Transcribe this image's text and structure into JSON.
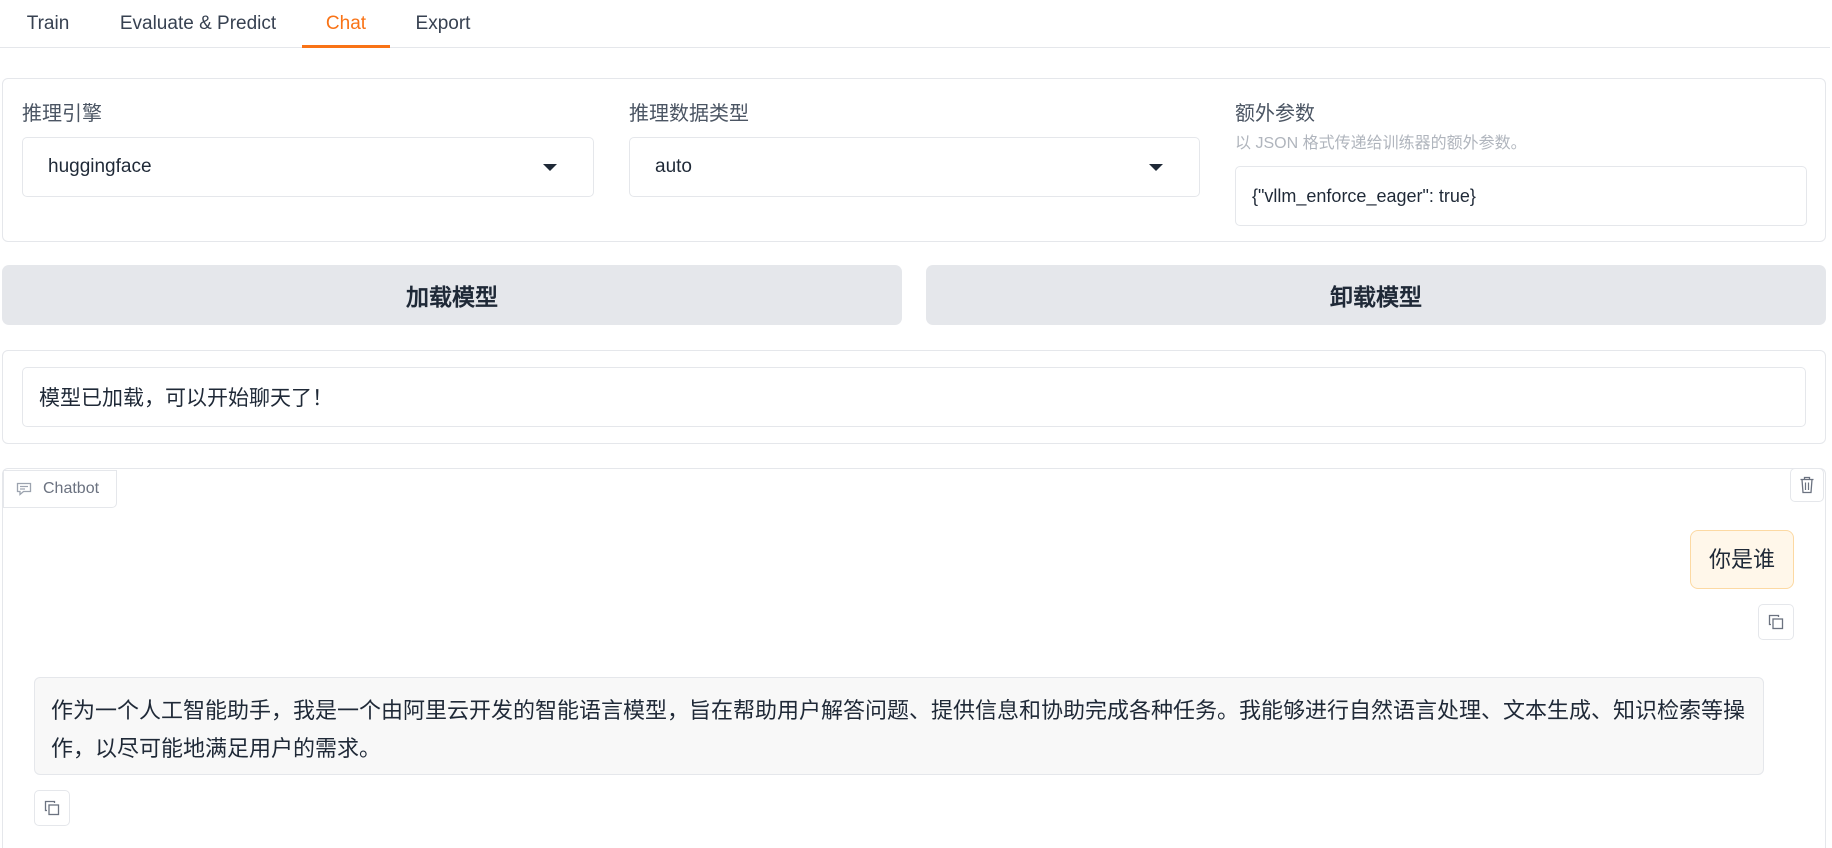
{
  "tabs": [
    {
      "label": "Train"
    },
    {
      "label": "Evaluate & Predict"
    },
    {
      "label": "Chat",
      "active": true
    },
    {
      "label": "Export"
    }
  ],
  "settings": {
    "infer_backend": {
      "label": "推理引擎",
      "value": "huggingface"
    },
    "infer_dtype": {
      "label": "推理数据类型",
      "value": "auto"
    },
    "extra_args": {
      "label": "额外参数",
      "info": "以 JSON 格式传递给训练器的额外参数。",
      "value": "{\"vllm_enforce_eager\": true}"
    }
  },
  "buttons": {
    "load_model": "加载模型",
    "unload_model": "卸载模型"
  },
  "status": {
    "value": "模型已加载，可以开始聊天了！"
  },
  "chatbot": {
    "label": "Chatbot",
    "messages": [
      {
        "role": "user",
        "text": "你是谁"
      },
      {
        "role": "assistant",
        "text": "作为一个人工智能助手，我是一个由阿里云开发的智能语言模型，旨在帮助用户解答问题、提供信息和协助完成各种任务。我能够进行自然语言处理、文本生成、知识检索等操作，以尽可能地满足用户的需求。"
      }
    ]
  },
  "colors": {
    "accent": "#f97316",
    "button_bg": "#e5e7eb",
    "user_bubble_bg": "#fff7ea",
    "bot_bubble_bg": "#f8f8f8"
  }
}
